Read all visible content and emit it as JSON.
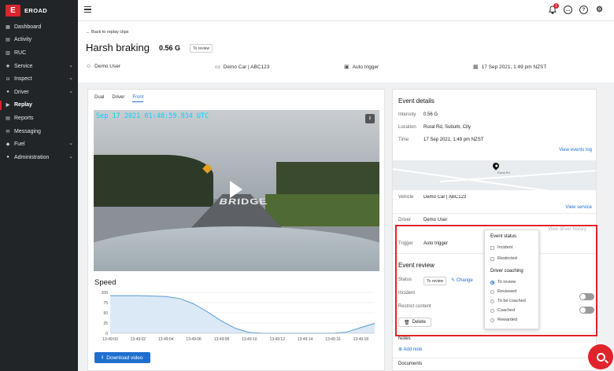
{
  "brand": {
    "name": "EROAD"
  },
  "sidebar": {
    "items": [
      {
        "label": "Dashboard",
        "icon": "dashboard-icon",
        "glyph": "▦",
        "chevron": false
      },
      {
        "label": "Activity",
        "icon": "activity-icon",
        "glyph": "▤",
        "chevron": false
      },
      {
        "label": "RUC",
        "icon": "ruc-icon",
        "glyph": "▥",
        "chevron": false
      },
      {
        "label": "Service",
        "icon": "service-icon",
        "glyph": "✚",
        "chevron": true
      },
      {
        "label": "Inspect",
        "icon": "inspect-icon",
        "glyph": "◘",
        "chevron": true
      },
      {
        "label": "Driver",
        "icon": "driver-icon",
        "glyph": "●",
        "chevron": true
      },
      {
        "label": "Replay",
        "icon": "replay-icon",
        "glyph": "▶",
        "chevron": false,
        "active": true
      },
      {
        "label": "Reports",
        "icon": "reports-icon",
        "glyph": "▤",
        "chevron": false
      },
      {
        "label": "Messaging",
        "icon": "messaging-icon",
        "glyph": "✉",
        "chevron": false
      },
      {
        "label": "Fuel",
        "icon": "fuel-icon",
        "glyph": "◆",
        "chevron": true
      },
      {
        "label": "Administration",
        "icon": "administration-icon",
        "glyph": "●",
        "chevron": true
      }
    ]
  },
  "topbar": {
    "notification_count": "1",
    "help_glyph": "?",
    "chat_glyph": "…",
    "settings_glyph": "⚙"
  },
  "event": {
    "back_label": "← Back to replay clips",
    "title": "Harsh braking",
    "intensity": "0.56 G",
    "status_tag": "To review",
    "user": "Demo User",
    "vehicle": "Demo Car | ABC123",
    "trigger": "Auto trigger",
    "datetime": "17 Sep 2021, 1:49 pm NZST"
  },
  "video": {
    "tabs": [
      "Dual",
      "Driver",
      "Front"
    ],
    "active_tab": "Front",
    "timestamp": "Sep 17 2021 01:48:59.934 UTC",
    "road_text": "BRIDGE",
    "download_label": "Download video"
  },
  "speed_chart_title": "Speed",
  "chart_data": {
    "type": "area",
    "title": "Speed",
    "x": [
      "13:49:00",
      "13:49:01",
      "13:49:02",
      "13:49:03",
      "13:49:04",
      "13:49:05",
      "13:49:06",
      "13:49:07",
      "13:49:08",
      "13:49:09",
      "13:49:10",
      "13:49:11",
      "13:49:12",
      "13:49:13",
      "13:49:14",
      "13:49:15",
      "13:49:16",
      "13:49:17",
      "13:49:18",
      "13:49:19"
    ],
    "series": [
      {
        "values": [
          92,
          92,
          92,
          91,
          90,
          85,
          72,
          52,
          30,
          12,
          2,
          0,
          0,
          0,
          0,
          0,
          0,
          3,
          14,
          24
        ]
      }
    ],
    "ylim": [
      0,
      100
    ],
    "yticks": [
      "100",
      "75",
      "50",
      "25",
      "0"
    ],
    "xticks": [
      "13:49:00",
      "13:49:02",
      "13:49:04",
      "13:49:06",
      "13:49:08",
      "13:49:10",
      "13:49:12",
      "13:49:14",
      "13:49:16",
      "13:49:18"
    ],
    "color": "#5b9bd5",
    "fill": "#dbe9f7",
    "grid": true
  },
  "details": {
    "heading": "Event details",
    "intensity_label": "Intensity",
    "intensity_value": "0.56 G",
    "location_label": "Location",
    "location_value": "Rural Rd, Suburb, City",
    "time_label": "Time",
    "time_value": "17 Sep 2021, 1:49 pm NZST",
    "view_events_log": "View events log",
    "map_label": "Rural Rd",
    "vehicle_label": "Vehicle",
    "vehicle_value": "Demo Car | ABC123",
    "view_service": "View service",
    "driver_label": "Driver",
    "driver_value": "Demo User",
    "view_driver_history": "View driver history",
    "trigger_label": "Trigger",
    "trigger_value": "Auto trigger"
  },
  "review": {
    "heading": "Event review",
    "status_label": "Status",
    "status_value": "To review",
    "change_label": "Change",
    "incident_label": "Incident",
    "restrict_label": "Restrict content",
    "delete_label": "Delete",
    "notes_label": "Notes",
    "add_note_label": "Add note",
    "documents_label": "Documents"
  },
  "popover": {
    "status_heading": "Event status",
    "status_options": [
      "Incident",
      "Restricted"
    ],
    "coaching_heading": "Driver coaching",
    "coaching_options": [
      "To review",
      "Reviewed",
      "To be coached",
      "Coached",
      "Rewarded"
    ],
    "selected_coaching": "To review"
  }
}
